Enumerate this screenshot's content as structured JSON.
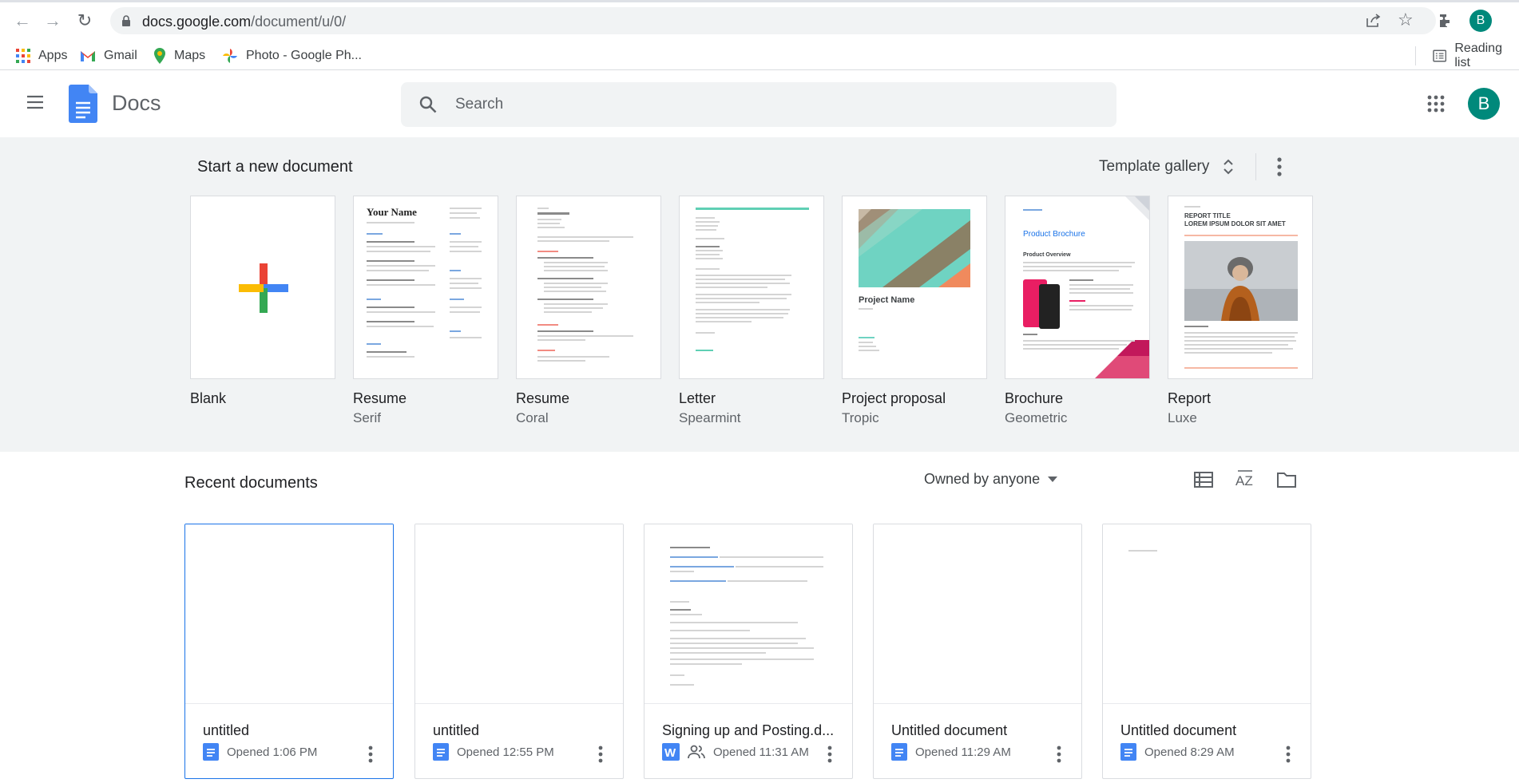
{
  "browser": {
    "url_host": "docs.google.com",
    "url_path": "/document/u/0/",
    "profile_initial": "B",
    "bookmarks": [
      "Apps",
      "Gmail",
      "Maps",
      "Photo - Google Ph..."
    ],
    "reading_list": "Reading list"
  },
  "header": {
    "app_name": "Docs",
    "search_placeholder": "Search",
    "avatar_initial": "B"
  },
  "templates": {
    "heading": "Start a new document",
    "gallery_label": "Template gallery",
    "items": [
      {
        "name": "Blank",
        "sub": ""
      },
      {
        "name": "Resume",
        "sub": "Serif"
      },
      {
        "name": "Resume",
        "sub": "Coral"
      },
      {
        "name": "Letter",
        "sub": "Spearmint"
      },
      {
        "name": "Project proposal",
        "sub": "Tropic"
      },
      {
        "name": "Brochure",
        "sub": "Geometric"
      },
      {
        "name": "Report",
        "sub": "Luxe"
      }
    ],
    "thumb_text": {
      "your_name": "Your Name",
      "project_name": "Project Name",
      "product_brochure": "Product Brochure",
      "product_overview": "Product Overview",
      "report_title": "REPORT TITLE",
      "report_subtitle": "LOREM IPSUM DOLOR SIT AMET"
    }
  },
  "recent": {
    "heading": "Recent documents",
    "owner_filter": "Owned by anyone",
    "docs": [
      {
        "title": "untitled",
        "meta": "Opened 1:06 PM",
        "type": "docs",
        "shared": false
      },
      {
        "title": "untitled",
        "meta": "Opened 12:55 PM",
        "type": "docs",
        "shared": false
      },
      {
        "title": "Signing up and Posting.d...",
        "meta": "Opened 11:31 AM",
        "type": "word",
        "shared": true
      },
      {
        "title": "Untitled document",
        "meta": "Opened 11:29 AM",
        "type": "docs",
        "shared": false
      },
      {
        "title": "Untitled document",
        "meta": "Opened 8:29 AM",
        "type": "docs",
        "shared": false
      }
    ]
  },
  "colors": {
    "docs_blue": "#4285f4",
    "accent_teal": "#00897b",
    "selected_border": "#1a73e8"
  }
}
